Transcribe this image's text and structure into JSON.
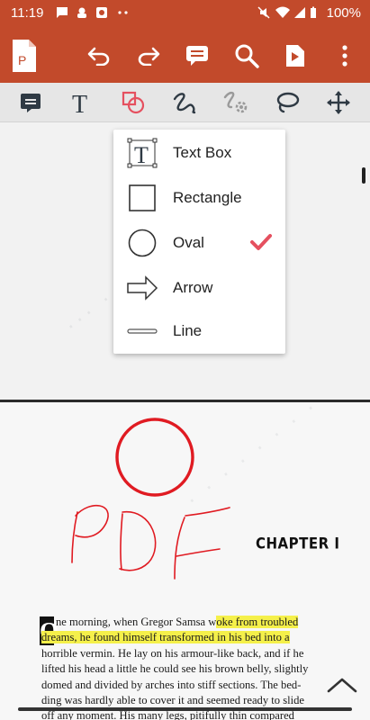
{
  "status_bar": {
    "time": "11:19",
    "battery": "100%",
    "left_icons": [
      "message-icon",
      "notification-icon",
      "app-icon",
      "more-dots-icon"
    ],
    "right_icons": [
      "mute-icon",
      "wifi-icon",
      "signal-icon",
      "battery-icon"
    ]
  },
  "app_bar": {
    "background": "#c24a2b",
    "buttons": [
      "app-logo-icon",
      "undo-icon",
      "redo-icon",
      "comment-icon",
      "search-icon",
      "slideshow-icon",
      "more-vert-icon"
    ]
  },
  "toolbar": {
    "tools": [
      "note-tool",
      "text-tool",
      "shape-tool",
      "freehand-tool",
      "eraser-tool",
      "lasso-tool",
      "move-tool"
    ],
    "active_tool": "shape-tool"
  },
  "shape_menu": {
    "items": [
      {
        "label": "Text Box",
        "icon": "text-box-icon",
        "selected": false
      },
      {
        "label": "Rectangle",
        "icon": "rectangle-icon",
        "selected": false
      },
      {
        "label": "Oval",
        "icon": "oval-icon",
        "selected": true
      },
      {
        "label": "Arrow",
        "icon": "arrow-icon",
        "selected": false
      },
      {
        "label": "Line",
        "icon": "line-icon",
        "selected": false
      }
    ],
    "check_color": "#e5505f"
  },
  "document": {
    "chapter": "CHAPTER I",
    "dropcap": "O",
    "lines": [
      {
        "pre": "ne morning, when Gregor Samsa w",
        "hl": "oke from troubled",
        "post": ""
      },
      {
        "pre": "",
        "hl": "dreams, he found himself transformed in his bed into a",
        "post": ""
      },
      {
        "pre": "horrible vermin. He lay on his armour-like back, and if he",
        "hl": "",
        "post": ""
      },
      {
        "pre": "lifted his head a little he could see his brown belly, slightly",
        "hl": "",
        "post": ""
      },
      {
        "pre": "domed and divided by arches into stiff sections. The bed-",
        "hl": "",
        "post": ""
      },
      {
        "pre": "ding was hardly able to cover it and seemed ready to slide",
        "hl": "",
        "post": ""
      },
      {
        "pre": "off any moment. His many legs, pitifully thin compared",
        "hl": "",
        "post": ""
      }
    ],
    "highlight_color": "#f5f04a",
    "annotation_color": "#e01b22"
  }
}
